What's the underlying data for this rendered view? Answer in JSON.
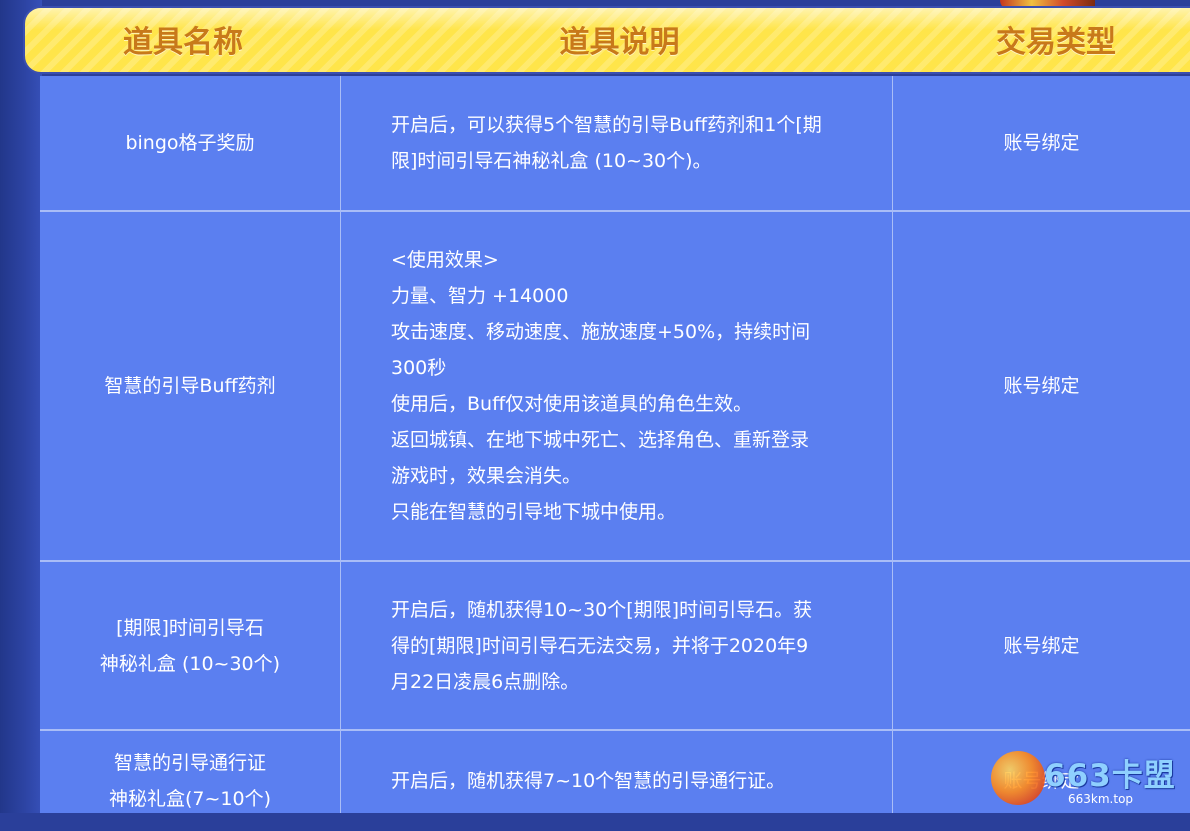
{
  "header": {
    "col_name": "道具名称",
    "col_desc": "道具说明",
    "col_trade": "交易类型"
  },
  "rows": [
    {
      "name": "bingo格子奖励",
      "desc": "开启后，可以获得5个智慧的引导Buff药剂和1个[期\n限]时间引导石神秘礼盒 (10~30个)。",
      "trade": "账号绑定"
    },
    {
      "name": "智慧的引导Buff药剂",
      "desc": "<使用效果>\n力量、智力 +14000\n攻击速度、移动速度、施放速度+50%，持续时间\n300秒\n使用后，Buff仅对使用该道具的角色生效。\n返回城镇、在地下城中死亡、选择角色、重新登录\n游戏时，效果会消失。\n只能在智慧的引导地下城中使用。",
      "trade": "账号绑定"
    },
    {
      "name": "[期限]时间引导石\n神秘礼盒 (10~30个)",
      "desc": "开启后，随机获得10~30个[期限]时间引导石。获\n得的[期限]时间引导石无法交易，并将于2020年9\n月22日凌晨6点删除。",
      "trade": "账号绑定"
    },
    {
      "name": "智慧的引导通行证\n神秘礼盒(7~10个)",
      "desc": "开启后，随机获得7~10个智慧的引导通行证。",
      "trade": "账号绑定"
    }
  ],
  "watermark": {
    "brand": "663卡盟",
    "url": "663km.top"
  },
  "colors": {
    "header_bg": "#ffe54a",
    "header_text": "#c8791a",
    "table_bg": "#5b7ff0",
    "grid_line": "#a9bdf7",
    "page_bg": "#2a3f9a"
  }
}
